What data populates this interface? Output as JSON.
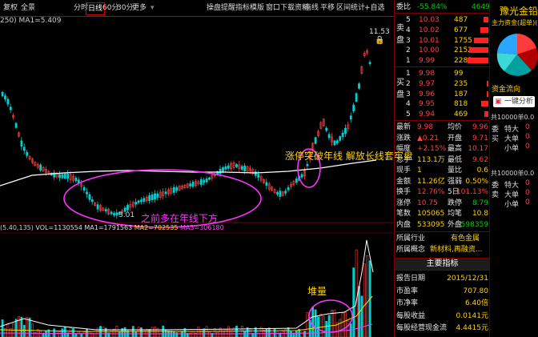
{
  "toolbar": {
    "left1": "复权",
    "left2": "全景",
    "periods": [
      "分时",
      "日线",
      "60分",
      "30分",
      "更多"
    ],
    "tools": [
      "操盘提醒",
      "指标模版",
      "窗口",
      "下载资料",
      "画线",
      "平移",
      "区间统计"
    ],
    "autosel": "+自选"
  },
  "main": {
    "indicator_line": "250)  MA1=5.409",
    "price_high": "11.53",
    "price_low": "3.01",
    "annot_main": "之前多在年线下方",
    "annot_break": "涨停突破年线 解放长线套牢盘",
    "vol_line_pre": "(5.40,135)",
    "vol_line_vol": "VOL=1130554",
    "vol_line_ma1": "MA1=1791563",
    "vol_line_ma2": "MA2=702535",
    "vol_line_ma3": "MA3=306180",
    "annot_vol": "堆量"
  },
  "order_book": {
    "header_label": "委比",
    "header_value": "-55.84%",
    "header_right": "4649",
    "sells": [
      {
        "level": "5",
        "price": "10.03",
        "vol": "487"
      },
      {
        "level": "4",
        "price": "10.02",
        "vol": "677"
      },
      {
        "level": "3",
        "price": "10.01",
        "vol": "1755"
      },
      {
        "level": "2",
        "price": "10.00",
        "vol": "2152"
      },
      {
        "level": "1",
        "price": "9.99",
        "vol": "2283"
      }
    ],
    "buys": [
      {
        "level": "1",
        "price": "9.98",
        "vol": "99"
      },
      {
        "level": "2",
        "price": "9.97",
        "vol": "235"
      },
      {
        "level": "3",
        "price": "9.96",
        "vol": "187"
      },
      {
        "level": "4",
        "price": "9.95",
        "vol": "818"
      },
      {
        "level": "5",
        "price": "9.94",
        "vol": "469"
      }
    ],
    "sell_label": "卖盘",
    "buy_label": "买盘"
  },
  "quote": [
    {
      "l": "最新",
      "lv": "9.98",
      "r": "均价",
      "rv": "9.96"
    },
    {
      "l": "涨跌",
      "lv": "▲0.21",
      "r": "开盘",
      "rv": "9.71"
    },
    {
      "l": "幅度",
      "lv": "+2.15%",
      "r": "最高",
      "rv": "10.17"
    },
    {
      "l": "总手",
      "lv": "113.1万",
      "r": "最低",
      "rv": "9.62"
    },
    {
      "l": "现手",
      "lv": "1",
      "r": "量比",
      "rv": "0.6"
    },
    {
      "l": "金额",
      "lv": "11.26亿",
      "r": "强弱",
      "rv": "0.50%"
    },
    {
      "l": "换手",
      "lv": "12.76%",
      "r": "5日",
      "rv": "101.13%"
    },
    {
      "l": "涨停",
      "lv": "10.75",
      "r": "跌停",
      "rv": "8.79"
    },
    {
      "l": "笔数",
      "lv": "105065",
      "r": "均笔",
      "rv": "10.8"
    },
    {
      "l": "内盘",
      "lv": "533095",
      "r": "外盘",
      "rv": "598359"
    }
  ],
  "industry": {
    "label": "所属行业",
    "value": "有色金属"
  },
  "concept": {
    "label": "所属概念",
    "value": "新材料,再融资..."
  },
  "metrics_title": "主要指标",
  "metrics": [
    {
      "l": "报告日期",
      "v": "2015/12/31"
    },
    {
      "l": "市盈率",
      "v": "707.80"
    },
    {
      "l": "市净率",
      "v": "6.40倍"
    },
    {
      "l": "每股收益",
      "v": "0.0141元"
    },
    {
      "l": "每股经营现金流",
      "v": "4.4415元"
    }
  ],
  "far_panel": {
    "title": "豫光金铅",
    "sub": "主力资金(超单)(手)",
    "funds_label": "资金流向",
    "app_label": "一键分析",
    "blocks": [
      {
        "head": "共10000单0.0",
        "rows": [
          {
            "l": "委",
            "r": "特大",
            "v": "0"
          },
          {
            "l": "买",
            "r": "大单",
            "v": "0"
          },
          {
            "l": "",
            "r": "小单",
            "v": "0"
          }
        ]
      },
      {
        "head": "共10000单0.0",
        "rows": [
          {
            "l": "委",
            "r": "特大",
            "v": "0"
          },
          {
            "l": "卖",
            "r": "大单",
            "v": "0"
          },
          {
            "l": "",
            "r": "小单",
            "v": "0"
          }
        ]
      }
    ]
  },
  "colors": {
    "up": "#ff4040",
    "down": "#00d0d0",
    "ma250": "#ffffff",
    "annot": "#ff33ff",
    "label_yellow": "#ffd200"
  }
}
